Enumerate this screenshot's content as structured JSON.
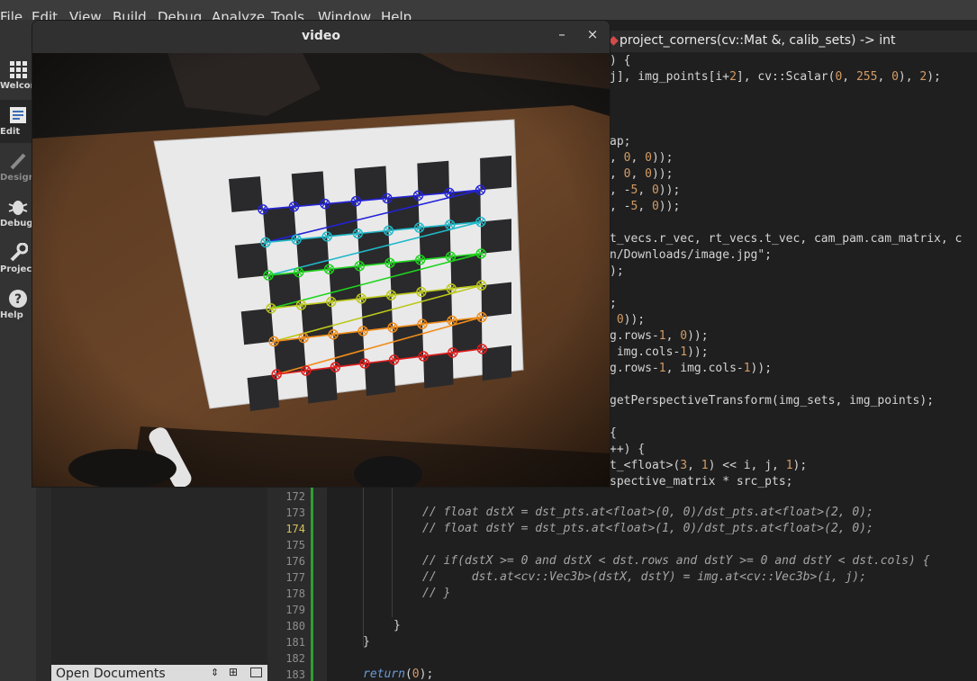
{
  "menu": [
    "File",
    "Edit",
    "View",
    "Build",
    "Debug",
    "Analyze",
    "Tools",
    "Window",
    "Help"
  ],
  "modes": [
    {
      "label": "Welcome",
      "icon": "grid-icon"
    },
    {
      "label": "Edit",
      "icon": "document-icon"
    },
    {
      "label": "Design",
      "icon": "pencil-icon"
    },
    {
      "label": "Debug",
      "icon": "bug-icon"
    },
    {
      "label": "Projects",
      "icon": "wrench-icon"
    },
    {
      "label": "Help",
      "icon": "help-icon"
    }
  ],
  "breadcrumb": {
    "function": "project_corners(cv::Mat &, calib_sets) -> int"
  },
  "editor": {
    "code_lines": [
      ") {",
      "j], img_points[i+2], cv::Scalar(0, 255, 0), 2);",
      "",
      "",
      "",
      "ap;",
      ", 0, 0));",
      ", 0, 0));",
      ", -5, 0));",
      ", -5, 0));",
      "",
      "t_vecs.r_vec, rt_vecs.t_vec, cam_pam.cam_matrix, c",
      "n/Downloads/image.jpg\";",
      ");",
      "",
      ";",
      " 0));",
      "g.rows-1, 0));",
      " img.cols-1));",
      "g.rows-1, img.cols-1));",
      "",
      "getPerspectiveTransform(img_sets, img_points);",
      "",
      "{",
      "++) {",
      "t_<float>(3, 1) << i, j, 1);",
      "spective_matrix * src_pts;"
    ],
    "lines": [
      {
        "n": "172",
        "text": "",
        "cls": ""
      },
      {
        "n": "173",
        "text": "// float dstX = dst_pts.at<float>(0, 0)/dst_pts.at<float>(2, 0);",
        "cls": "cmt"
      },
      {
        "n": "174",
        "text": "// float dstY = dst_pts.at<float>(1, 0)/dst_pts.at<float>(2, 0);",
        "cls": "cmt"
      },
      {
        "n": "175",
        "text": "",
        "cls": ""
      },
      {
        "n": "176",
        "text": "// if(dstX >= 0 and dstX < dst.rows and dstY >= 0 and dstY < dst.cols) {",
        "cls": "cmt"
      },
      {
        "n": "177",
        "text": "//     dst.at<cv::Vec3b>(dstX, dstY) = img.at<cv::Vec3b>(i, j);",
        "cls": "cmt"
      },
      {
        "n": "178",
        "text": "// }",
        "cls": "cmt"
      },
      {
        "n": "179",
        "text": "",
        "cls": ""
      },
      {
        "n": "180",
        "text": "}",
        "cls": ""
      },
      {
        "n": "181",
        "text": "}",
        "cls": ""
      },
      {
        "n": "182",
        "text": "",
        "cls": ""
      },
      {
        "n": "183",
        "text": "return(0);",
        "cls": ""
      }
    ],
    "current_line": "174"
  },
  "open_documents": {
    "label": "Open Documents"
  },
  "video_window": {
    "title": "video",
    "minimize": "–",
    "close": "×",
    "corner_rows": [
      {
        "color": "#2323d8"
      },
      {
        "color": "#20b8c8"
      },
      {
        "color": "#1ed41e"
      },
      {
        "color": "#bcc81a"
      },
      {
        "color": "#f08c1a"
      },
      {
        "color": "#e01c1c"
      }
    ]
  }
}
